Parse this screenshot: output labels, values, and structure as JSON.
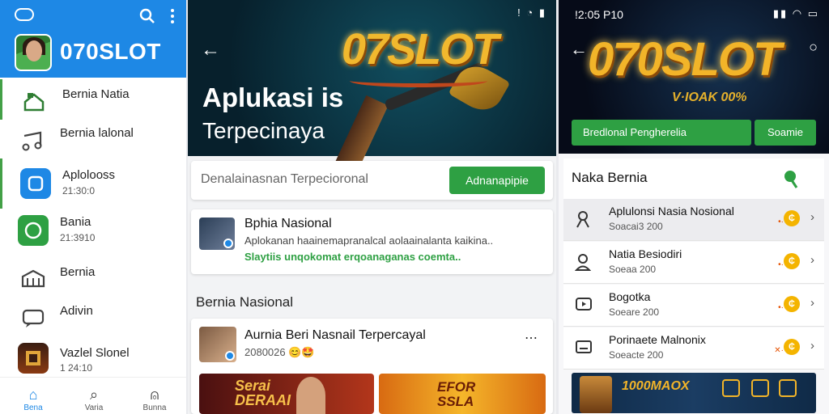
{
  "p1": {
    "brand": "070SLOT",
    "items": [
      {
        "label": "Bernia Natia",
        "sub": ""
      },
      {
        "label": "Bernia lalonal",
        "sub": ""
      },
      {
        "label": "Aplolooss",
        "sub": "21:30:0"
      },
      {
        "label": "Bania",
        "sub": "21:3910"
      },
      {
        "label": "Bernia",
        "sub": ""
      },
      {
        "label": "Adivin",
        "sub": ""
      },
      {
        "label": "Vazlel Slonel",
        "sub": "1 24:10"
      }
    ],
    "nav": [
      "Bena",
      "Varia",
      "Bunna"
    ]
  },
  "p2": {
    "status": "!  ◔ ▮",
    "hero_logo": "07SLOT",
    "hero_title": "Aplukasi is",
    "hero_subtitle": "Terpecinaya",
    "search_placeholder": "Denalainasnan Terpecioronal",
    "search_button": "Adnanapipie",
    "post1": {
      "title": "Bphia Nasional",
      "body": "Aplokanan haainemapranalcal aolaainalanta kaikina..",
      "green": "Slaytiis  unqokomat  erqoanaganas coemta.."
    },
    "section_title": "Bernia Nasional",
    "post2": {
      "title": "Aurnia Beri Nasnail Terpercayal",
      "meta": "2080026",
      "emoji": "😊🤩",
      "more": "⋯"
    },
    "banner1": "Serai\nDERAAI",
    "banner2": "EFOR\nSSLA"
  },
  "p3": {
    "time": "!2:05 P10",
    "hero_logo": "070SLOT",
    "hero_tag": "V·IOAK 00%",
    "input": "Bredlonal Pengherelia",
    "button": "Soamie",
    "head": "Naka Bernia",
    "rows": [
      {
        "title": "Aplulonsi Nasia Nosional",
        "sub": "Soacai3 200"
      },
      {
        "title": "Natia Besiodiri",
        "sub": "Soeaa 200"
      },
      {
        "title": "Bogotka",
        "sub": "Soeare 200"
      },
      {
        "title": "Porinaete Malnonix",
        "sub": "Soeacte 200"
      }
    ],
    "banner": "1000MAOX"
  },
  "colors": {
    "brand_blue": "#1e88e5",
    "green": "#2ea043",
    "gold": "#f2b429"
  },
  "icons": [
    "cloud-icon",
    "search-icon",
    "more-vert-icon",
    "home-icon",
    "user-icon",
    "chevron-right-icon",
    "location-pin-icon",
    "back-arrow-icon"
  ]
}
